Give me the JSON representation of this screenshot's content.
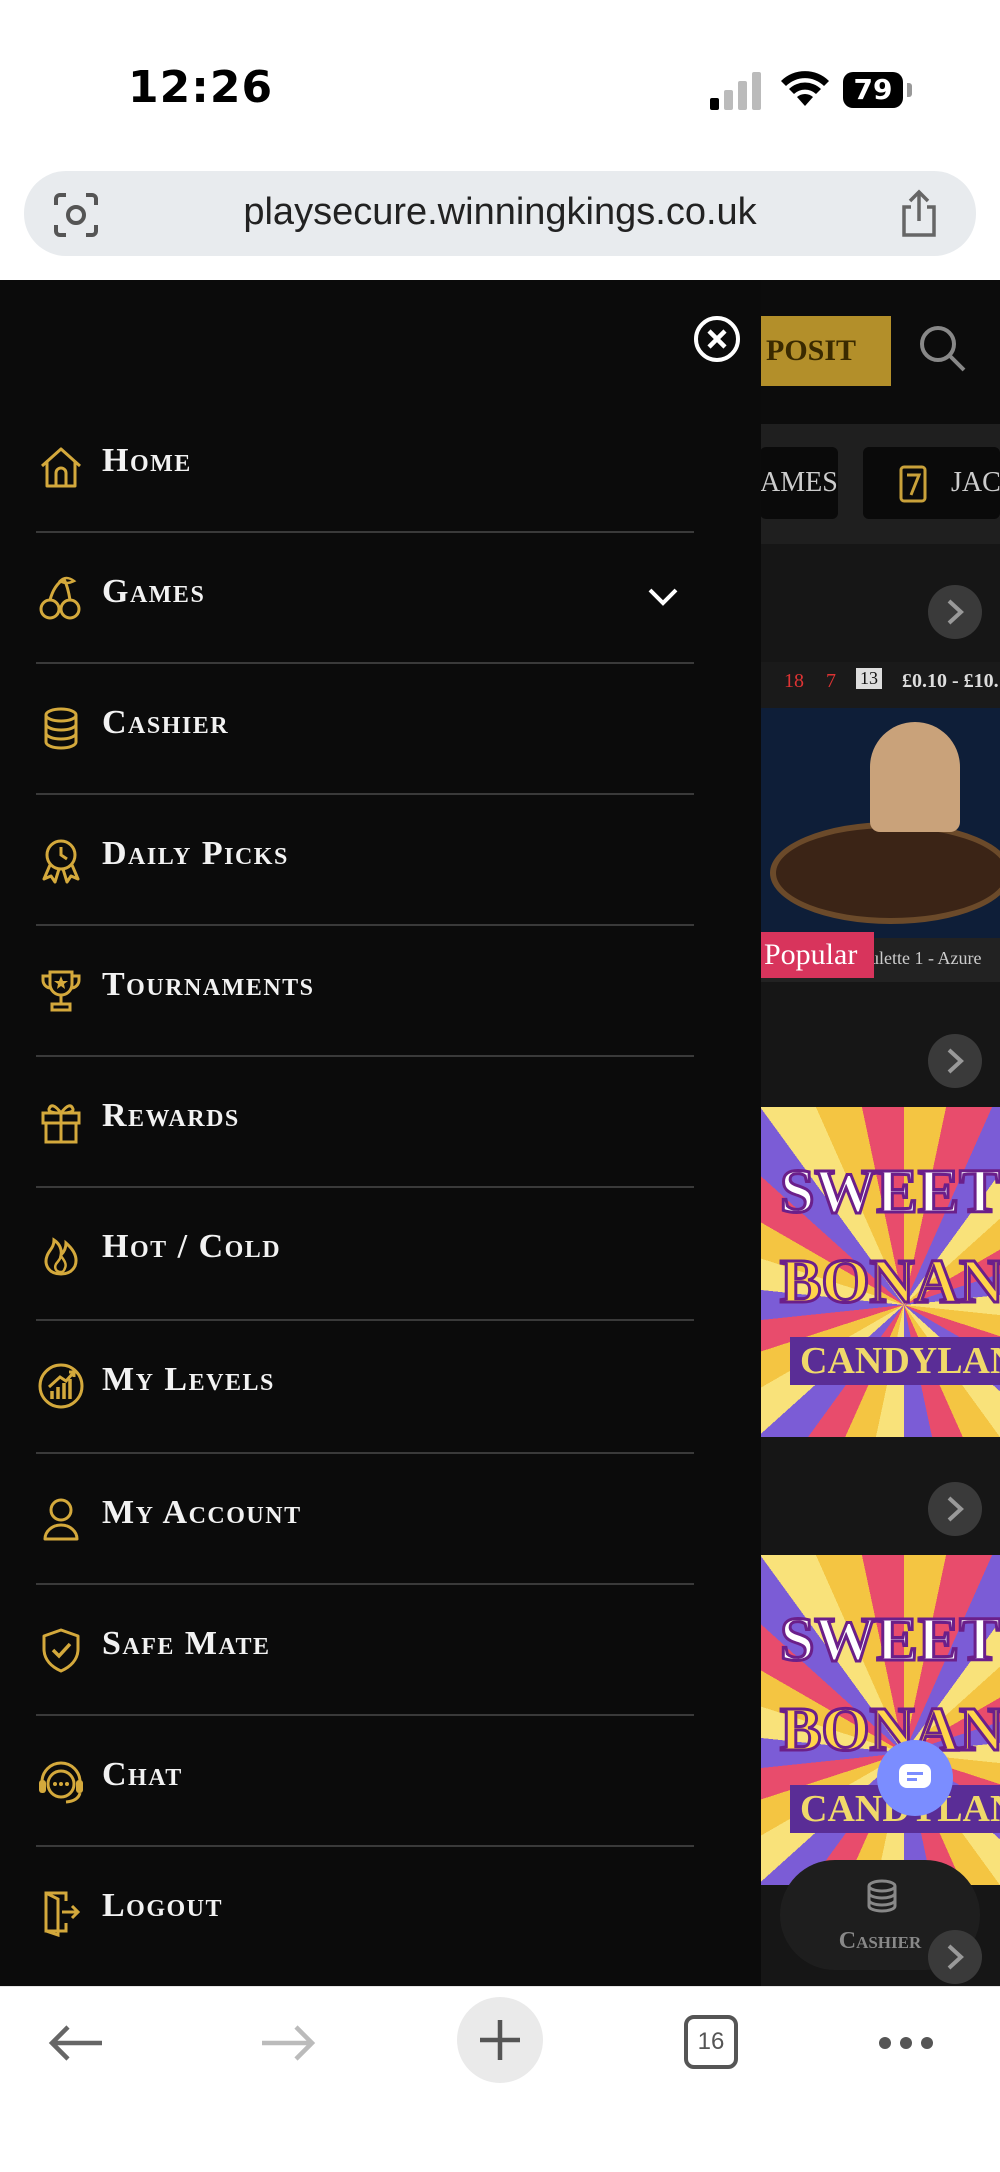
{
  "status": {
    "time": "12:26",
    "battery": "79"
  },
  "browser": {
    "url": "playsecure.winningkings.co.uk",
    "tab_count": "16"
  },
  "background_page": {
    "deposit_label": "POSIT",
    "tabs": [
      "AMES",
      "JACK"
    ],
    "roulette": {
      "numbers": [
        "18",
        "7",
        "13"
      ],
      "stake_range": "£0.10 - £10.",
      "caption": "ulette 1 - Azure",
      "badge": "Popular"
    },
    "slot_title_1": "SWEET",
    "slot_title_2": "BONANZ",
    "slot_subtitle": "CANDYLAN",
    "cashier_label": "Cashier"
  },
  "menu": {
    "items": [
      {
        "label": "Home",
        "icon": "home-icon"
      },
      {
        "label": "Games",
        "icon": "cherries-icon",
        "expandable": true
      },
      {
        "label": "Cashier",
        "icon": "coins-icon"
      },
      {
        "label": "Daily Picks",
        "icon": "badge-clock-icon"
      },
      {
        "label": "Tournaments",
        "icon": "trophy-icon"
      },
      {
        "label": "Rewards",
        "icon": "gift-icon"
      },
      {
        "label": "Hot / Cold",
        "icon": "flame-icon"
      },
      {
        "label": "My Levels",
        "icon": "levels-chart-icon"
      },
      {
        "label": "My Account",
        "icon": "user-icon"
      },
      {
        "label": "Safe Mate",
        "icon": "shield-check-icon"
      },
      {
        "label": "Chat",
        "icon": "headset-chat-icon"
      },
      {
        "label": "Logout",
        "icon": "logout-icon"
      }
    ]
  },
  "colors": {
    "gold": "#d4a93c",
    "drawer_bg": "#0b0b0b",
    "divider": "#3a3a3a"
  }
}
